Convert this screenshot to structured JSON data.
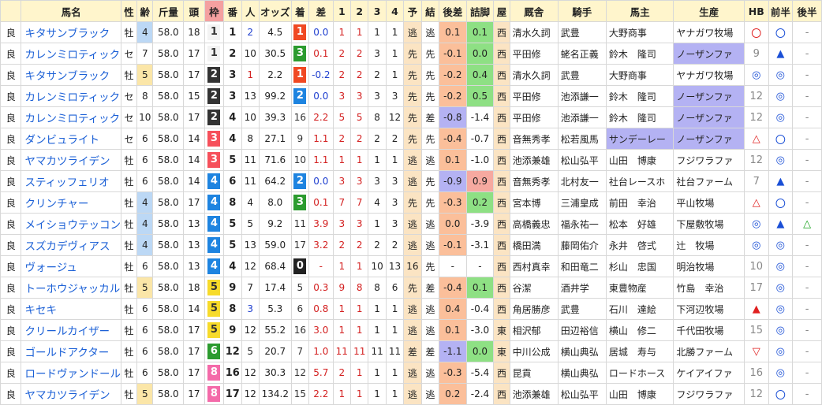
{
  "headers": [
    "",
    "馬名",
    "性",
    "齢",
    "斤量",
    "頭",
    "枠",
    "番",
    "人",
    "オッズ",
    "着",
    "差",
    "1",
    "2",
    "3",
    "4",
    "予",
    "結",
    "後差",
    "詰脚",
    "屋",
    "厩舎",
    "騎手",
    "馬主",
    "生産",
    "HB",
    "前半",
    "後半"
  ],
  "rows": [
    {
      "track": "良",
      "name": "キタサンブラック",
      "sex": "牡",
      "age": "4",
      "w": "58.0",
      "n": "18",
      "waku": "1",
      "ban": "1",
      "pop": "2",
      "odds": "4.5",
      "res": "1",
      "diff": "0.0",
      "c1": "1",
      "c2": "1",
      "c3": "1",
      "c4": "1",
      "yo": "逃",
      "ke": "逃",
      "ato": "0.1",
      "tsume": "0.1",
      "ya": "西",
      "kyu": "清水久詞",
      "jk": "武豊",
      "own": "大野商事",
      "prod": "ヤナガワ牧場",
      "hb": "〇",
      "zen": "〇",
      "kou": "-"
    },
    {
      "track": "良",
      "name": "カレンミロティック",
      "sex": "セ",
      "age": "7",
      "w": "58.0",
      "n": "17",
      "waku": "1",
      "ban": "2",
      "pop": "10",
      "odds": "30.5",
      "res": "3",
      "diff": "0.1",
      "c1": "2",
      "c2": "2",
      "c3": "3",
      "c4": "1",
      "yo": "先",
      "ke": "先",
      "ato": "-0.1",
      "tsume": "0.0",
      "ya": "西",
      "kyu": "平田修",
      "jk": "蛯名正義",
      "own": "鈴木　隆司",
      "prod": "ノーザンファ",
      "hb": "9",
      "zen": "▲",
      "kou": "-"
    },
    {
      "track": "良",
      "name": "キタサンブラック",
      "sex": "牡",
      "age": "5",
      "w": "58.0",
      "n": "17",
      "waku": "2",
      "ban": "3",
      "pop": "1",
      "odds": "2.2",
      "res": "1",
      "diff": "-0.2",
      "c1": "2",
      "c2": "2",
      "c3": "2",
      "c4": "1",
      "yo": "先",
      "ke": "先",
      "ato": "-0.2",
      "tsume": "0.4",
      "ya": "西",
      "kyu": "清水久詞",
      "jk": "武豊",
      "own": "大野商事",
      "prod": "ヤナガワ牧場",
      "hb": "◎",
      "zen": "◎",
      "kou": "-"
    },
    {
      "track": "良",
      "name": "カレンミロティック",
      "sex": "セ",
      "age": "8",
      "w": "58.0",
      "n": "15",
      "waku": "2",
      "ban": "3",
      "pop": "13",
      "odds": "99.2",
      "res": "2",
      "diff": "0.0",
      "c1": "3",
      "c2": "3",
      "c3": "3",
      "c4": "3",
      "yo": "先",
      "ke": "先",
      "ato": "-0.2",
      "tsume": "0.5",
      "ya": "西",
      "kyu": "平田修",
      "jk": "池添謙一",
      "own": "鈴木　隆司",
      "prod": "ノーザンファ",
      "hb": "12",
      "zen": "◎",
      "kou": "-"
    },
    {
      "track": "良",
      "name": "カレンミロティック",
      "sex": "セ",
      "age": "10",
      "w": "58.0",
      "n": "17",
      "waku": "2",
      "ban": "4",
      "pop": "10",
      "odds": "39.3",
      "res": "16",
      "diff": "2.2",
      "c1": "5",
      "c2": "5",
      "c3": "8",
      "c4": "12",
      "yo": "先",
      "ke": "差",
      "ato": "-0.8",
      "tsume": "-1.4",
      "ya": "西",
      "kyu": "平田修",
      "jk": "池添謙一",
      "own": "鈴木　隆司",
      "prod": "ノーザンファ",
      "hb": "12",
      "zen": "◎",
      "kou": "-"
    },
    {
      "track": "良",
      "name": "ダンビュライト",
      "sex": "セ",
      "age": "6",
      "w": "58.0",
      "n": "14",
      "waku": "3",
      "ban": "4",
      "pop": "8",
      "odds": "27.1",
      "res": "9",
      "diff": "1.1",
      "c1": "2",
      "c2": "2",
      "c3": "2",
      "c4": "2",
      "yo": "先",
      "ke": "先",
      "ato": "-0.4",
      "tsume": "-0.7",
      "ya": "西",
      "kyu": "音無秀孝",
      "jk": "松若風馬",
      "own": "サンデーレー",
      "prod": "ノーザンファ",
      "hb": "△",
      "zen": "〇",
      "kou": "-"
    },
    {
      "track": "良",
      "name": "ヤマカツライデン",
      "sex": "牡",
      "age": "6",
      "w": "58.0",
      "n": "14",
      "waku": "3",
      "ban": "5",
      "pop": "11",
      "odds": "71.6",
      "res": "10",
      "diff": "1.1",
      "c1": "1",
      "c2": "1",
      "c3": "1",
      "c4": "1",
      "yo": "逃",
      "ke": "逃",
      "ato": "0.1",
      "tsume": "-1.0",
      "ya": "西",
      "kyu": "池添兼雄",
      "jk": "松山弘平",
      "own": "山田　博康",
      "prod": "フジワラファ",
      "hb": "12",
      "zen": "◎",
      "kou": "-"
    },
    {
      "track": "良",
      "name": "スティッフェリオ",
      "sex": "牡",
      "age": "6",
      "w": "58.0",
      "n": "14",
      "waku": "4",
      "ban": "6",
      "pop": "11",
      "odds": "64.2",
      "res": "2",
      "diff": "0.0",
      "c1": "3",
      "c2": "3",
      "c3": "3",
      "c4": "3",
      "yo": "逃",
      "ke": "先",
      "ato": "-0.9",
      "tsume": "0.9",
      "ya": "西",
      "kyu": "音無秀孝",
      "jk": "北村友一",
      "own": "社台レースホ",
      "prod": "社台ファーム",
      "hb": "7",
      "zen": "▲",
      "kou": "-"
    },
    {
      "track": "良",
      "name": "クリンチャー",
      "sex": "牡",
      "age": "4",
      "w": "58.0",
      "n": "17",
      "waku": "4",
      "ban": "8",
      "pop": "4",
      "odds": "8.0",
      "res": "3",
      "diff": "0.1",
      "c1": "7",
      "c2": "7",
      "c3": "4",
      "c4": "3",
      "yo": "先",
      "ke": "先",
      "ato": "-0.3",
      "tsume": "0.2",
      "ya": "西",
      "kyu": "宮本博",
      "jk": "三浦皇成",
      "own": "前田　幸治",
      "prod": "平山牧場",
      "hb": "△",
      "zen": "〇",
      "kou": "-"
    },
    {
      "track": "良",
      "name": "メイショウテッコン",
      "sex": "牡",
      "age": "4",
      "w": "58.0",
      "n": "13",
      "waku": "4",
      "ban": "5",
      "pop": "5",
      "odds": "9.2",
      "res": "11",
      "diff": "3.9",
      "c1": "3",
      "c2": "3",
      "c3": "1",
      "c4": "3",
      "yo": "逃",
      "ke": "逃",
      "ato": "0.0",
      "tsume": "-3.9",
      "ya": "西",
      "kyu": "高橋義忠",
      "jk": "福永祐一",
      "own": "松本　好雄",
      "prod": "下屋敷牧場",
      "hb": "◎",
      "zen": "▲",
      "kou": "△"
    },
    {
      "track": "良",
      "name": "スズカデヴィアス",
      "sex": "牡",
      "age": "4",
      "w": "58.0",
      "n": "13",
      "waku": "4",
      "ban": "5",
      "pop": "13",
      "odds": "59.0",
      "res": "17",
      "diff": "3.2",
      "c1": "2",
      "c2": "2",
      "c3": "2",
      "c4": "2",
      "yo": "逃",
      "ke": "逃",
      "ato": "-0.1",
      "tsume": "-3.1",
      "ya": "西",
      "kyu": "橋田満",
      "jk": "藤岡佑介",
      "own": "永井　啓弍",
      "prod": "辻　牧場",
      "hb": "◎",
      "zen": "◎",
      "kou": "-"
    },
    {
      "track": "良",
      "name": "ヴォージュ",
      "sex": "牡",
      "age": "6",
      "w": "58.0",
      "n": "13",
      "waku": "4",
      "ban": "4",
      "pop": "12",
      "odds": "68.4",
      "res": "0",
      "diff": "-",
      "c1": "1",
      "c2": "1",
      "c3": "10",
      "c4": "13",
      "yo": "16",
      "ke": "先",
      "ato": "-",
      "tsume": "-",
      "ya": "西",
      "kyu": "西村真幸",
      "jk": "和田竜二",
      "own": "杉山　忠国",
      "prod": "明治牧場",
      "hb": "10",
      "zen": "◎",
      "kou": "-"
    },
    {
      "track": "良",
      "name": "トーホウジャッカル",
      "sex": "牡",
      "age": "5",
      "w": "58.0",
      "n": "18",
      "waku": "5",
      "ban": "9",
      "pop": "7",
      "odds": "17.4",
      "res": "5",
      "diff": "0.3",
      "c1": "9",
      "c2": "8",
      "c3": "8",
      "c4": "6",
      "yo": "先",
      "ke": "差",
      "ato": "-0.4",
      "tsume": "0.1",
      "ya": "西",
      "kyu": "谷潔",
      "jk": "酒井学",
      "own": "東豊物産",
      "prod": "竹島　幸治",
      "hb": "17",
      "zen": "◎",
      "kou": "-"
    },
    {
      "track": "良",
      "name": "キセキ",
      "sex": "牡",
      "age": "6",
      "w": "58.0",
      "n": "14",
      "waku": "5",
      "ban": "8",
      "pop": "3",
      "odds": "5.3",
      "res": "6",
      "diff": "0.8",
      "c1": "1",
      "c2": "1",
      "c3": "1",
      "c4": "1",
      "yo": "逃",
      "ke": "逃",
      "ato": "0.4",
      "tsume": "-0.4",
      "ya": "西",
      "kyu": "角居勝彦",
      "jk": "武豊",
      "own": "石川　達絵",
      "prod": "下河辺牧場",
      "hb": "▲",
      "zen": "◎",
      "kou": "-"
    },
    {
      "track": "良",
      "name": "クリールカイザー",
      "sex": "牡",
      "age": "6",
      "w": "58.0",
      "n": "17",
      "waku": "5",
      "ban": "9",
      "pop": "12",
      "odds": "55.2",
      "res": "16",
      "diff": "3.0",
      "c1": "1",
      "c2": "1",
      "c3": "1",
      "c4": "1",
      "yo": "逃",
      "ke": "逃",
      "ato": "0.1",
      "tsume": "-3.0",
      "ya": "東",
      "kyu": "相沢郁",
      "jk": "田辺裕信",
      "own": "横山　修二",
      "prod": "千代田牧場",
      "hb": "15",
      "zen": "◎",
      "kou": "-"
    },
    {
      "track": "良",
      "name": "ゴールドアクター",
      "sex": "牡",
      "age": "6",
      "w": "58.0",
      "n": "17",
      "waku": "6",
      "ban": "12",
      "pop": "5",
      "odds": "20.7",
      "res": "7",
      "diff": "1.0",
      "c1": "11",
      "c2": "11",
      "c3": "11",
      "c4": "11",
      "yo": "差",
      "ke": "差",
      "ato": "-1.1",
      "tsume": "0.0",
      "ya": "東",
      "kyu": "中川公成",
      "jk": "横山典弘",
      "own": "居城　寿与",
      "prod": "北勝ファーム",
      "hb": "▽",
      "zen": "◎",
      "kou": "-"
    },
    {
      "track": "良",
      "name": "ロードヴァンドール",
      "sex": "牡",
      "age": "6",
      "w": "58.0",
      "n": "17",
      "waku": "8",
      "ban": "16",
      "pop": "12",
      "odds": "30.3",
      "res": "12",
      "diff": "5.7",
      "c1": "2",
      "c2": "1",
      "c3": "1",
      "c4": "1",
      "yo": "逃",
      "ke": "逃",
      "ato": "-0.3",
      "tsume": "-5.4",
      "ya": "西",
      "kyu": "昆貢",
      "jk": "横山典弘",
      "own": "ロードホース",
      "prod": "ケイアイファ",
      "hb": "16",
      "zen": "◎",
      "kou": "-"
    },
    {
      "track": "良",
      "name": "ヤマカツライデン",
      "sex": "牡",
      "age": "5",
      "w": "58.0",
      "n": "17",
      "waku": "8",
      "ban": "17",
      "pop": "12",
      "odds": "134.2",
      "res": "15",
      "diff": "2.2",
      "c1": "1",
      "c2": "1",
      "c3": "1",
      "c4": "1",
      "yo": "逃",
      "ke": "逃",
      "ato": "0.2",
      "tsume": "-2.4",
      "ya": "西",
      "kyu": "池添兼雄",
      "jk": "松山弘平",
      "own": "山田　博康",
      "prod": "フジワラファ",
      "hb": "12",
      "zen": "〇",
      "kou": "-"
    }
  ]
}
